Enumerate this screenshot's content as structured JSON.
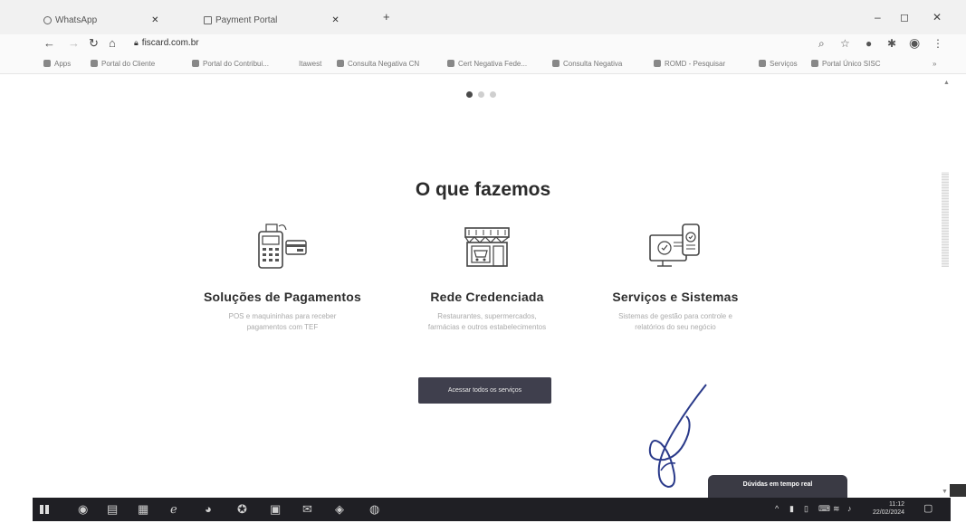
{
  "browser": {
    "tabs": [
      {
        "label": "WhatsApp"
      },
      {
        "label": "Payment Portal"
      }
    ],
    "new_tab_label": "+",
    "url": "fiscard.com.br",
    "window_controls": {
      "minimize": "–",
      "maximize": "◻",
      "close": "✕"
    }
  },
  "bookmarks": [
    {
      "label": "Apps"
    },
    {
      "label": "Portal do Cliente"
    },
    {
      "label": "Portal do Contribui..."
    },
    {
      "label": "Itawest"
    },
    {
      "label": "Consulta Negativa CN"
    },
    {
      "label": "Cert Negativa Fede..."
    },
    {
      "label": "Consulta Negativa"
    },
    {
      "label": "ROMD - Pesquisar"
    },
    {
      "label": "Serviços"
    },
    {
      "label": "Portal Único SISC"
    }
  ],
  "page": {
    "section_title": "O que fazemos",
    "services": [
      {
        "title": "Soluções de Pagamentos",
        "description": "POS e maquininhas para receber pagamentos com TEF",
        "icon": "pos-terminal-icon"
      },
      {
        "title": "Rede Credenciada",
        "description": "Restaurantes, supermercados, farmácias e outros estabelecimentos",
        "icon": "storefront-icon"
      },
      {
        "title": "Serviços e Sistemas",
        "description": "Sistemas de gestão para controle e relatórios do seu negócio",
        "icon": "monitor-phone-icon"
      }
    ],
    "cta_label": "Acessar todos os serviços",
    "chat_label": "Dúvidas em tempo real"
  },
  "taskbar": {
    "time": "11:12",
    "date": "22/02/2024"
  },
  "colors": {
    "title": "#2b2b2b",
    "cta_background": "#3f3f4d",
    "taskbar": "#1f1f24"
  }
}
